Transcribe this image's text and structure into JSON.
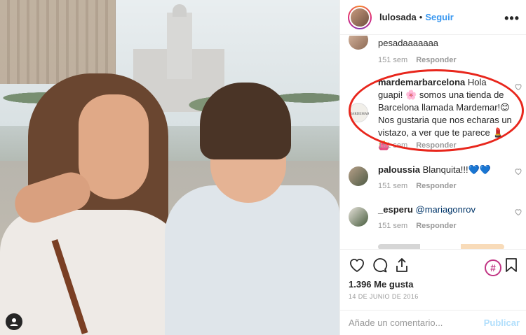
{
  "post": {
    "username": "lulosada",
    "separator": "•",
    "follow_label": "Seguir",
    "more_label": "•••"
  },
  "comments": [
    {
      "username": "",
      "text": "pesadaaaaaaa",
      "time": "151 sem",
      "reply": "Responder"
    },
    {
      "username": "mardemarbarcelona",
      "text": "Hola guapi! 🌸 somos una tienda de Barcelona llamada Mardemar!😊 Nos gustaria que nos echaras un vistazo, a ver que te parece 💄👛",
      "time": "151 sem",
      "reply": "Responder"
    },
    {
      "username": "paloussia",
      "text": "Blanquita!!!💙💙",
      "time": "151 sem",
      "reply": "Responder"
    },
    {
      "username": "_esperu",
      "mention": "@mariagonrov",
      "time": "151 sem",
      "reply": "Responder"
    }
  ],
  "actions": {
    "likes": "1.396 Me gusta",
    "date": "14 DE JUNIO DE 2016",
    "hashtag_symbol": "#",
    "comment_placeholder": "Añade un comentario...",
    "publish_label": "Publicar"
  },
  "colors": {
    "accent": "#3897f0",
    "highlight_oval": "#e8261c",
    "muted": "#999999"
  }
}
